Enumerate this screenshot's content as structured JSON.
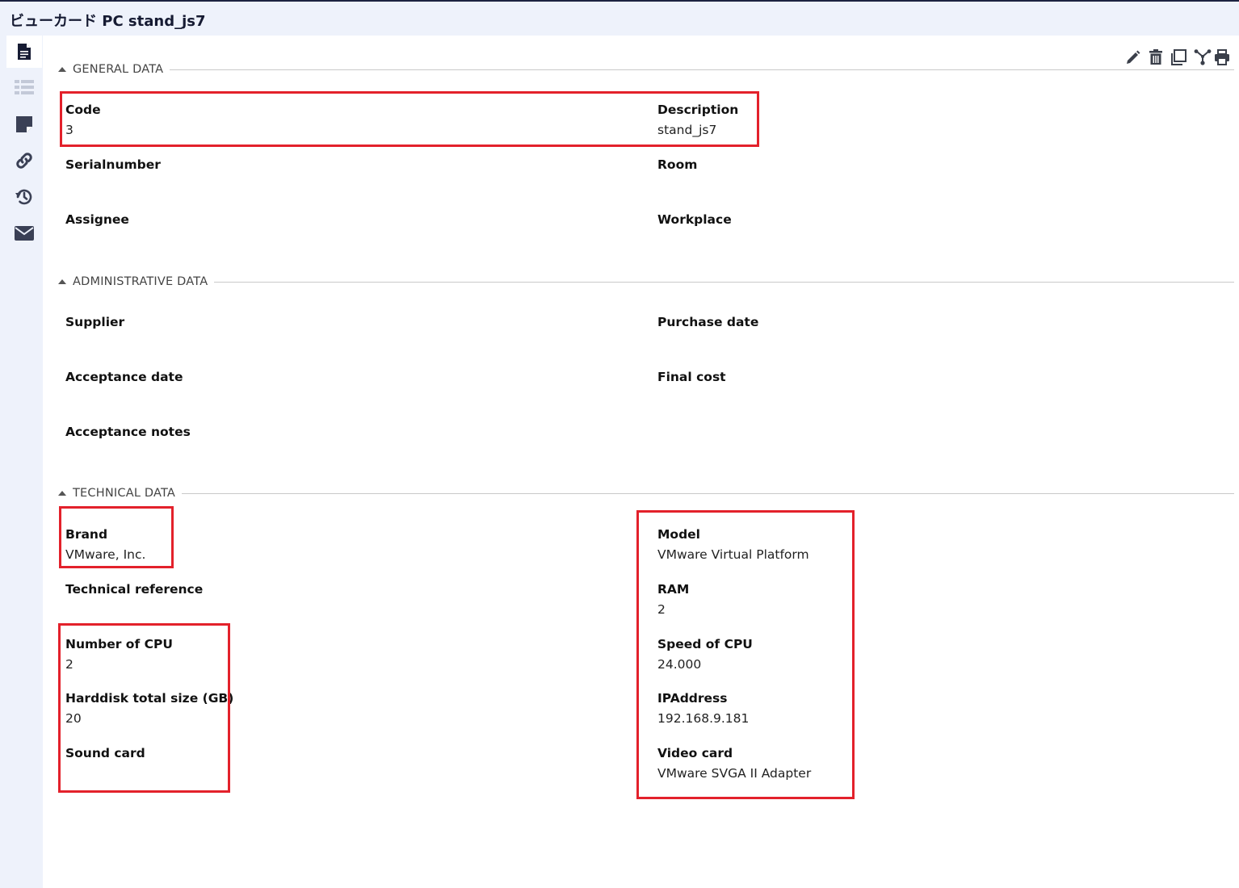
{
  "window": {
    "title": "ビューカード PC stand_js7"
  },
  "sidebar": {
    "tabs": [
      {
        "icon": "document-icon",
        "active": true
      },
      {
        "icon": "list-icon",
        "active": false
      },
      {
        "icon": "note-icon",
        "active": false
      },
      {
        "icon": "link-icon",
        "active": false
      },
      {
        "icon": "history-icon",
        "active": false
      },
      {
        "icon": "email-icon",
        "active": false
      }
    ]
  },
  "toolbar": {
    "icons": [
      "edit-icon",
      "delete-icon",
      "clone-icon",
      "relation-graph-icon",
      "print-icon"
    ]
  },
  "sections": {
    "general": {
      "title": "GENERAL DATA",
      "fields": {
        "code": {
          "label": "Code",
          "value": "3"
        },
        "description": {
          "label": "Description",
          "value": "stand_js7"
        },
        "serialnumber": {
          "label": "Serialnumber",
          "value": ""
        },
        "room": {
          "label": "Room",
          "value": ""
        },
        "assignee": {
          "label": "Assignee",
          "value": ""
        },
        "workplace": {
          "label": "Workplace",
          "value": ""
        }
      }
    },
    "administrative": {
      "title": "ADMINISTRATIVE DATA",
      "fields": {
        "supplier": {
          "label": "Supplier",
          "value": ""
        },
        "purchase_date": {
          "label": "Purchase date",
          "value": ""
        },
        "acceptance_date": {
          "label": "Acceptance date",
          "value": ""
        },
        "final_cost": {
          "label": "Final cost",
          "value": ""
        },
        "acceptance_notes": {
          "label": "Acceptance notes",
          "value": ""
        }
      }
    },
    "technical": {
      "title": "TECHNICAL DATA",
      "fields": {
        "brand": {
          "label": "Brand",
          "value": "VMware, Inc."
        },
        "model": {
          "label": "Model",
          "value": "VMware Virtual Platform"
        },
        "technical_reference": {
          "label": "Technical reference",
          "value": ""
        },
        "ram": {
          "label": "RAM",
          "value": "2"
        },
        "cpu_count": {
          "label": "Number of CPU",
          "value": "2"
        },
        "cpu_speed": {
          "label": "Speed of CPU",
          "value": "24.000"
        },
        "hdd_size": {
          "label": "Harddisk total size (GB)",
          "value": "20"
        },
        "ip_address": {
          "label": "IPAddress",
          "value": "192.168.9.181"
        },
        "sound_card": {
          "label": "Sound card",
          "value": ""
        },
        "video_card": {
          "label": "Video card",
          "value": "VMware SVGA II Adapter"
        }
      }
    }
  },
  "colors": {
    "sidebar_bg": "#eef2fb",
    "highlight": "#e3212b",
    "title_text": "#161b33"
  }
}
